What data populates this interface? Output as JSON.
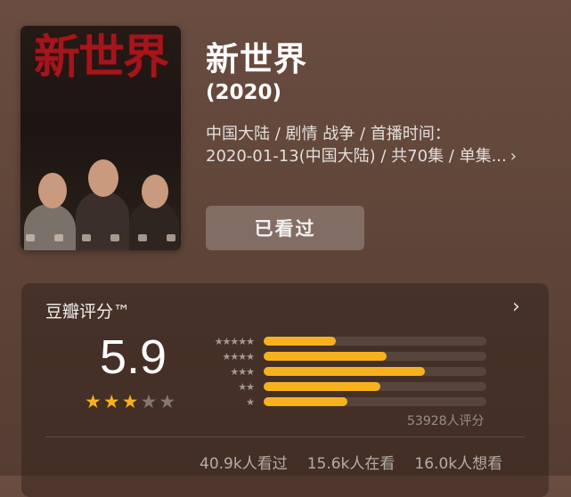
{
  "movie": {
    "title": "新世界",
    "year": "(2020)",
    "meta_line1": "中国大陆 / 剧情 战争 / 首播时间：",
    "meta_line2": "2020-01-13(中国大陆) / 共70集 / 单集...",
    "poster_title": "新世界"
  },
  "actions": {
    "watched_label": "已看过"
  },
  "rating": {
    "section_title": "豆瓣评分™",
    "score": "5.9",
    "stars": [
      true,
      true,
      true,
      false,
      false
    ],
    "distribution": [
      {
        "stars": 5,
        "percent": 13
      },
      {
        "stars": 4,
        "percent": 22
      },
      {
        "stars": 3,
        "percent": 29
      },
      {
        "stars": 2,
        "percent": 21
      },
      {
        "stars": 1,
        "percent": 15
      }
    ],
    "count_text": "53928人评分",
    "stats": [
      "40.9k人看过",
      "15.6k人在看",
      "16.0k人想看"
    ]
  },
  "colors": {
    "accent": "#f6b21e",
    "poster_red": "#a3161c"
  }
}
